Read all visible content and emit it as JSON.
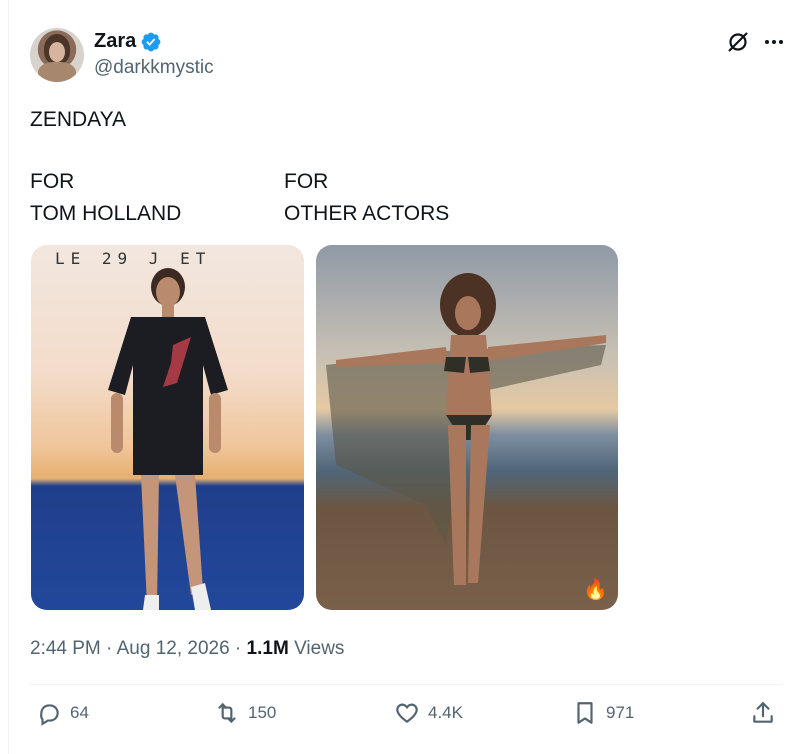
{
  "author": {
    "name": "Zara",
    "handle": "@darkkmystic",
    "verified": true,
    "verified_color": "#1d9bf0"
  },
  "tweet": {
    "text": "ZENDAYA",
    "columns": [
      {
        "line1": "FOR",
        "line2": "TOM HOLLAND"
      },
      {
        "line1": "FOR",
        "line2": "OTHER ACTORS"
      }
    ],
    "media": [
      {
        "overlay_text": "LE 29 J    ET"
      },
      {
        "emoji": "🔥"
      }
    ]
  },
  "meta": {
    "time": "2:44 PM",
    "separator": " · ",
    "date": "Aug 12, 2026",
    "views_count": "1.1M",
    "views_label": " Views"
  },
  "actions": {
    "replies": "64",
    "reposts": "150",
    "likes": "4.4K",
    "bookmarks": "971"
  },
  "icons": [
    "grok-icon",
    "more-icon",
    "reply-icon",
    "retweet-icon",
    "like-icon",
    "bookmark-icon",
    "share-icon"
  ],
  "colors": {
    "text_primary": "#0f1419",
    "text_secondary": "#536471",
    "divider": "#eff3f4"
  }
}
